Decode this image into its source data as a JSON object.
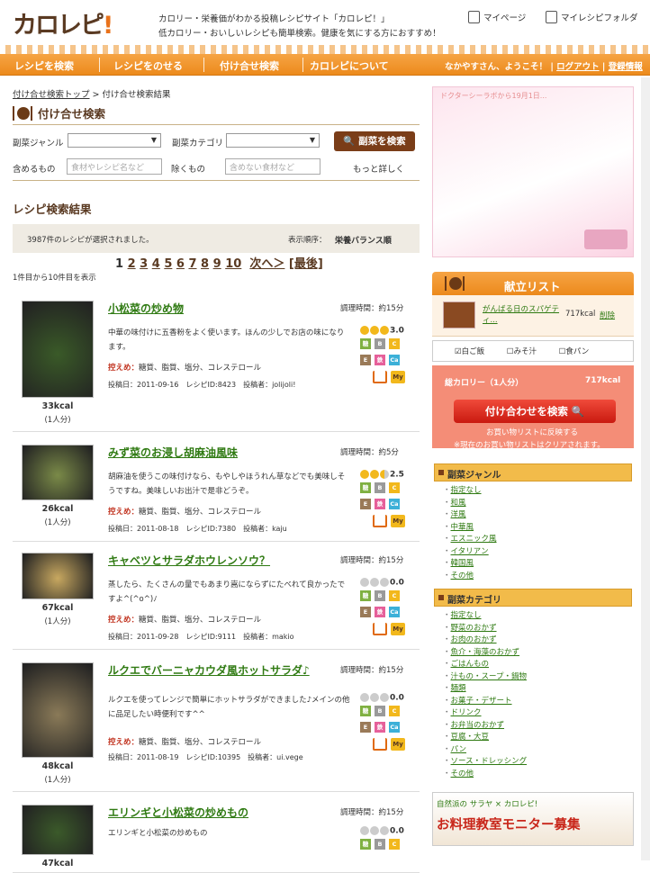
{
  "header": {
    "logo": "カロレピ!",
    "tagline1": "カロリー・栄養価がわかる投稿レシピサイト「カロレピ！」",
    "tagline2": "低カロリー・おいしいレシピも簡単検索。健康を気にする方におすすめ！",
    "mypage": "マイページ",
    "myfolder": "マイレシピフォルダ"
  },
  "nav": {
    "items": [
      "レシピを検索",
      "レシピをのせる",
      "付け合せ検索",
      "カロレピについて"
    ],
    "greeting": "なかやすさん、ようこそ！",
    "logout": "ログアウト",
    "register": "登録情報"
  },
  "breadcrumb": {
    "top": "付け合せ検索トップ",
    "sep": ">",
    "current": "付け合せ検索結果"
  },
  "search": {
    "title": "付け合せ検索",
    "genre_label": "副菜ジャンル",
    "category_label": "副菜カテゴリ",
    "button": "副菜を検索",
    "include_label": "含めるもの",
    "include_ph": "食材やレシピ名など",
    "exclude_label": "除くもの",
    "exclude_ph": "含めない食材など",
    "more": "もっと詳しく"
  },
  "results": {
    "title": "レシピ検索結果",
    "count": "3987件のレシピが選択されました。",
    "order_label": "表示順序：",
    "order_value": "栄養バランス順",
    "pages": [
      "1",
      "2",
      "3",
      "4",
      "5",
      "6",
      "7",
      "8",
      "9",
      "10"
    ],
    "next": "次へ＞",
    "last": "[最後]",
    "range": "1件目から10件目を表示"
  },
  "recipes": [
    {
      "title": "小松菜の炒め物",
      "time": "調理時間：約15分",
      "desc": "中華の味付けに五香粉をよく使います。ほんの少しでお店の味になります。",
      "cat": "控えめ：",
      "cat_items": "糖質、脂質、塩分、コレステロール",
      "meta": "投稿日：2011-09-16　レシピID:8423　投稿者：jolijoli!",
      "rating": "3.0",
      "stars": 3,
      "kcal": "33kcal",
      "people": "(1人分)",
      "thumb": "#3a5a28"
    },
    {
      "title": "みず菜のお浸し胡麻油風味",
      "time": "調理時間：約5分",
      "desc": "胡麻油を使うこの味付けなら、もやしやほうれん草などでも美味しそうですね。美味しいお出汁で是非どうぞ。",
      "cat": "控えめ：",
      "cat_items": "糖質、脂質、塩分、コレステロール",
      "meta": "投稿日：2011-08-18　レシピID:7380　投稿者：kaju",
      "rating": "2.5",
      "stars": 2.5,
      "kcal": "26kcal",
      "people": "(1人分)",
      "thumb": "#7a8a48"
    },
    {
      "title": "キャベツとサラダホウレンソウ？",
      "time": "調理時間：約15分",
      "desc": "蒸したら、たくさんの量でもあまり嵩にならずにたべれて良かったですよ^(^o^)ﾉ",
      "cat": "控えめ：",
      "cat_items": "糖質、脂質、塩分、コレステロール",
      "meta": "投稿日：2011-09-28　レシピID:9111　投稿者：makio",
      "rating": "0.0",
      "stars": 0,
      "kcal": "67kcal",
      "people": "(1人分)",
      "thumb": "#c8a860"
    },
    {
      "title": "ルクエでバーニャカウダ風ホットサラダ♪",
      "time": "調理時間：約15分",
      "desc": "ルクエを使ってレンジで簡単にホットサラダができました♪メインの他に品足したい時便利です^^",
      "cat": "控えめ：",
      "cat_items": "糖質、脂質、塩分、コレステロール",
      "meta": "投稿日：2011-08-19　レシピID:10395　投稿者：ui.vege",
      "rating": "0.0",
      "stars": 0,
      "kcal": "48kcal",
      "people": "(1人分)",
      "thumb": "#8a7a58"
    },
    {
      "title": "エリンギと小松菜の炒めもの",
      "time": "調理時間：約15分",
      "desc": "エリンギと小松菜の炒めもの",
      "cat": "",
      "cat_items": "",
      "meta": "",
      "rating": "0.0",
      "stars": 0,
      "kcal": "47kcal",
      "people": "",
      "thumb": "#3b5a2a"
    }
  ],
  "badges": {
    "b1": "糖",
    "b2": "B",
    "b3": "C",
    "b4": "E",
    "b5": "鉄",
    "b6": "Ca",
    "my": "My"
  },
  "kondate": {
    "title": "献立リスト",
    "item": "がんばる日のスパゲティ...",
    "kcal": "717kcal",
    "delete": "削除",
    "chk1": "白ご飯",
    "chk2": "みそ汁",
    "chk3": "食パン",
    "total_label": "総カロリー（1人分）",
    "total": "717kcal",
    "button": "付け合わせを検索",
    "note1": "お買い物リストに反映する",
    "note2": "※現在のお買い物リストはクリアされます。"
  },
  "genres": {
    "title": "副菜ジャンル",
    "items": [
      "指定なし",
      "和風",
      "洋風",
      "中華風",
      "エスニック風",
      "イタリアン",
      "韓国風",
      "その他"
    ]
  },
  "categories": {
    "title": "副菜カテゴリ",
    "items": [
      "指定なし",
      "野菜のおかず",
      "お肉のおかず",
      "魚介・海藻のおかず",
      "ごはんもの",
      "汁もの・スープ・鍋物",
      "麺類",
      "お菓子・デザート",
      "ドリンク",
      "お弁当のおかず",
      "豆腐・大豆",
      "パン",
      "ソース・ドレッシング",
      "その他"
    ]
  },
  "ad1": {
    "text": "ドクターシーラボから19月1日..."
  },
  "ad2": {
    "line1": "自然派の サラヤ × カロレピ!",
    "line2": "お料理教室モニター募集"
  },
  "colors": {
    "accent": "#ec8a1c",
    "brand": "#5a3a22",
    "link": "#2f7a12"
  }
}
